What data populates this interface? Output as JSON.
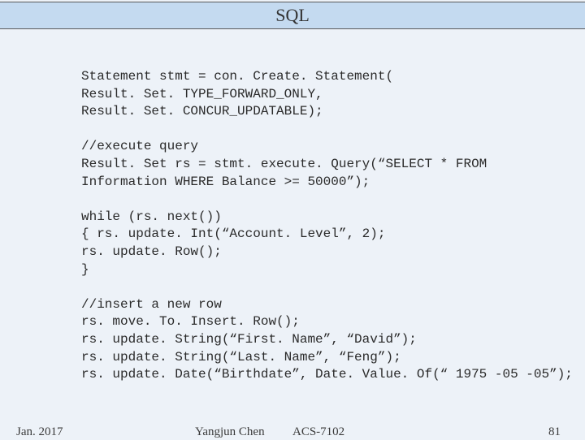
{
  "title": "SQL",
  "code": "Statement stmt = con. Create. Statement(\nResult. Set. TYPE_FORWARD_ONLY,\nResult. Set. CONCUR_UPDATABLE);\n\n//execute query\nResult. Set rs = stmt. execute. Query(“SELECT * FROM\nInformation WHERE Balance >= 50000”);\n\nwhile (rs. next())\n{ rs. update. Int(“Account. Level”, 2);\nrs. update. Row();\n}\n\n//insert a new row\nrs. move. To. Insert. Row();\nrs. update. String(“First. Name”, “David”);\nrs. update. String(“Last. Name”, “Feng”);\nrs. update. Date(“Birthdate”, Date. Value. Of(“ 1975 -05 -05”);",
  "footer": {
    "date": "Jan. 2017",
    "author": "Yangjun Chen",
    "course": "ACS-7102",
    "page": "81"
  }
}
